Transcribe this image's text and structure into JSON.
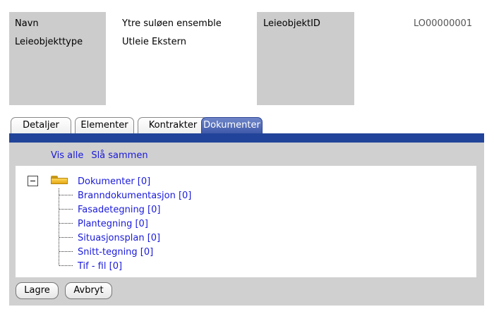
{
  "header": {
    "navn_label": "Navn",
    "navn_value": "Ytre suløen ensemble",
    "type_label": "Leieobjekttype",
    "type_value": "Utleie Ekstern",
    "id_label": "LeieobjektID",
    "id_value": "LO00000001"
  },
  "tabs": [
    "Detaljer",
    "Elementer",
    "Kontrakter",
    "Dokumenter"
  ],
  "active_tab": "Dokumenter",
  "links": {
    "show_all": "Vis alle",
    "collapse_all": "Slå sammen"
  },
  "tree": {
    "root": "Dokumenter [0]",
    "children": [
      "Branndokumentasjon [0]",
      "Fasadetegning [0]",
      "Plantegning [0]",
      "Situasjonsplan [0]",
      "Snitt-tegning [0]",
      "Tif - fil [0]"
    ]
  },
  "buttons": {
    "save": "Lagre",
    "cancel": "Avbryt"
  },
  "colors": {
    "accent_bar": "#21449a",
    "active_tab": "#3a55a8",
    "link": "#1a1adb",
    "panel": "#d0d0d0"
  }
}
